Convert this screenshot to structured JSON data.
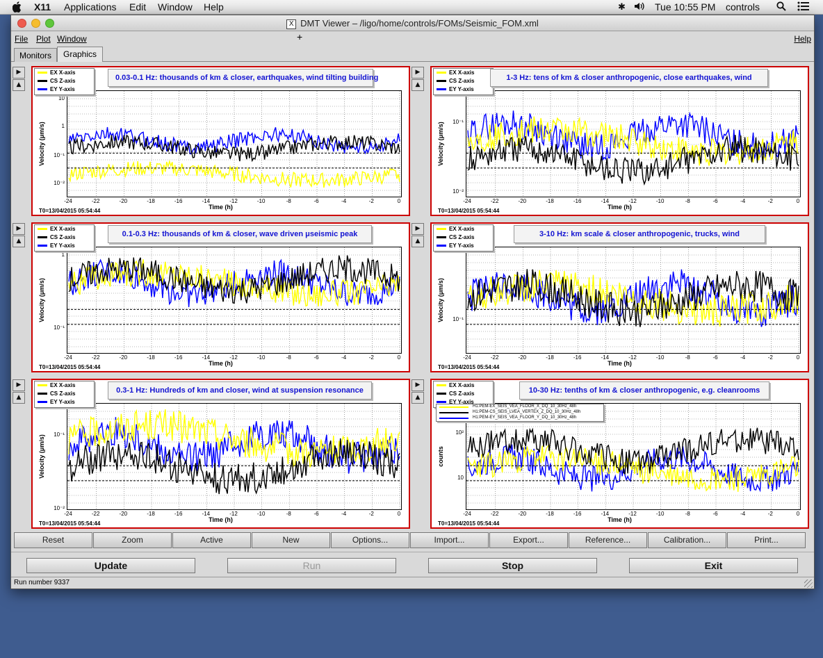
{
  "os_menu": {
    "app": "X11",
    "items": [
      "Applications",
      "Edit",
      "Window",
      "Help"
    ],
    "clock": "Tue 10:55 PM",
    "user": "controls"
  },
  "window": {
    "title": "DMT Viewer – /ligo/home/controls/FOMs/Seismic_FOM.xml",
    "icon_letter": "X"
  },
  "app_menu": {
    "file": "File",
    "plot": "Plot",
    "window": "Window",
    "help": "Help"
  },
  "tabs": [
    {
      "label": "Monitors",
      "active": false
    },
    {
      "label": "Graphics",
      "active": true
    }
  ],
  "legend_default": [
    {
      "name": "EX X-axis",
      "color": "#ffff00"
    },
    {
      "name": "CS Z-axis",
      "color": "#000000"
    },
    {
      "name": "EY Y-axis",
      "color": "#0000ff"
    }
  ],
  "legend_channels": [
    {
      "name": "H1:PEM-EX_SEIS_VEA_FLOOR_X_DQ_10_30Hz_48h",
      "color": "#ffff00"
    },
    {
      "name": "H1:PEM-CS_SEIS_LVEA_VERTEX_Z_DQ_10_30Hz_48h",
      "color": "#000000"
    },
    {
      "name": "H1:PEM-EY_SEIS_VEA_FLOOR_Y_DQ_10_30Hz_48h",
      "color": "#0000ff"
    }
  ],
  "x_ticks": [
    "-24",
    "-22",
    "-20",
    "-18",
    "-16",
    "-14",
    "-12",
    "-10",
    "-8",
    "-6",
    "-4",
    "-2",
    "0"
  ],
  "xlabel": "Time (h)",
  "t0": "T0=13/04/2015 05:54:44",
  "chart_data": [
    {
      "type": "line",
      "title": "0.03-0.1 Hz: thousands of km & closer, earthquakes, wind tilting building",
      "ylabel": "Velocity (μm/s)",
      "yscale": "log",
      "ylim": [
        0.01,
        15
      ],
      "y_ticks": [
        "10",
        "1",
        "10⁻¹",
        "10⁻²"
      ],
      "series": [
        {
          "name": "EX X-axis",
          "color": "#ffff00",
          "level": 0.05
        },
        {
          "name": "CS Z-axis",
          "color": "#000000",
          "level": 0.3
        },
        {
          "name": "EY Y-axis",
          "color": "#0000ff",
          "level": 0.5
        }
      ]
    },
    {
      "type": "line",
      "title": "1-3 Hz: tens of km & closer anthropogenic, close earthquakes, wind",
      "ylabel": "Velocity (μm/s)",
      "yscale": "log",
      "ylim": [
        0.01,
        0.5
      ],
      "y_ticks": [
        "10⁻¹",
        "10⁻²"
      ],
      "series": [
        {
          "name": "EX X-axis",
          "color": "#ffff00",
          "level": 0.08
        },
        {
          "name": "CS Z-axis",
          "color": "#000000",
          "level": 0.04
        },
        {
          "name": "EY Y-axis",
          "color": "#0000ff",
          "level": 0.1
        }
      ]
    },
    {
      "type": "line",
      "title": "0.1-0.3 Hz: thousands of km & closer, wave driven μseismic peak",
      "ylabel": "Velocity (μm/s)",
      "yscale": "log",
      "ylim": [
        0.02,
        1.2
      ],
      "y_ticks": [
        "1",
        "10⁻¹"
      ],
      "series": [
        {
          "name": "EX X-axis",
          "color": "#ffff00",
          "level": 0.3
        },
        {
          "name": "CS Z-axis",
          "color": "#000000",
          "level": 0.35
        },
        {
          "name": "EY Y-axis",
          "color": "#0000ff",
          "level": 0.3
        }
      ]
    },
    {
      "type": "line",
      "title": "3-10 Hz: km scale & closer anthropogenic, trucks, wind",
      "ylabel": "Velocity (μm/s)",
      "yscale": "log",
      "ylim": [
        0.05,
        1.5
      ],
      "y_ticks": [
        "10⁻¹"
      ],
      "series": [
        {
          "name": "EX X-axis",
          "color": "#ffff00",
          "level": 0.3
        },
        {
          "name": "CS Z-axis",
          "color": "#000000",
          "level": 0.3
        },
        {
          "name": "EY Y-axis",
          "color": "#0000ff",
          "level": 0.3
        }
      ]
    },
    {
      "type": "line",
      "title": "0.3-1 Hz: Hundreds of km and closer, wind at suspension resonance",
      "ylabel": "Velocity (μm/s)",
      "yscale": "log",
      "ylim": [
        0.01,
        0.3
      ],
      "y_ticks": [
        "10⁻¹",
        "10⁻²"
      ],
      "series": [
        {
          "name": "EX X-axis",
          "color": "#ffff00",
          "level": 0.1
        },
        {
          "name": "CS Z-axis",
          "color": "#000000",
          "level": 0.04
        },
        {
          "name": "EY Y-axis",
          "color": "#0000ff",
          "level": 0.08
        }
      ]
    },
    {
      "type": "line",
      "title": "10-30 Hz: tenths of km & closer anthropogenic, e.g. cleanrooms",
      "ylabel": "counts",
      "yscale": "log",
      "ylim": [
        5,
        300
      ],
      "y_ticks": [
        "10²",
        "10"
      ],
      "series": [
        {
          "name": "H1:PEM-EX_SEIS_VEA_FLOOR_X_DQ_10_30Hz_48h",
          "color": "#ffff00",
          "level": 25
        },
        {
          "name": "H1:PEM-CS_SEIS_LVEA_VERTEX_Z_DQ_10_30Hz_48h",
          "color": "#000000",
          "level": 50
        },
        {
          "name": "H1:PEM-EY_SEIS_VEA_FLOOR_Y_DQ_10_30Hz_48h",
          "color": "#0000ff",
          "level": 25
        }
      ]
    }
  ],
  "toolbar": [
    "Reset",
    "Zoom",
    "Active",
    "New",
    "Options...",
    "Import...",
    "Export...",
    "Reference...",
    "Calibration...",
    "Print..."
  ],
  "actions": [
    {
      "label": "Update",
      "enabled": true
    },
    {
      "label": "Run",
      "enabled": false
    },
    {
      "label": "Stop",
      "enabled": true
    },
    {
      "label": "Exit",
      "enabled": true
    }
  ],
  "status": "Run number 9337"
}
